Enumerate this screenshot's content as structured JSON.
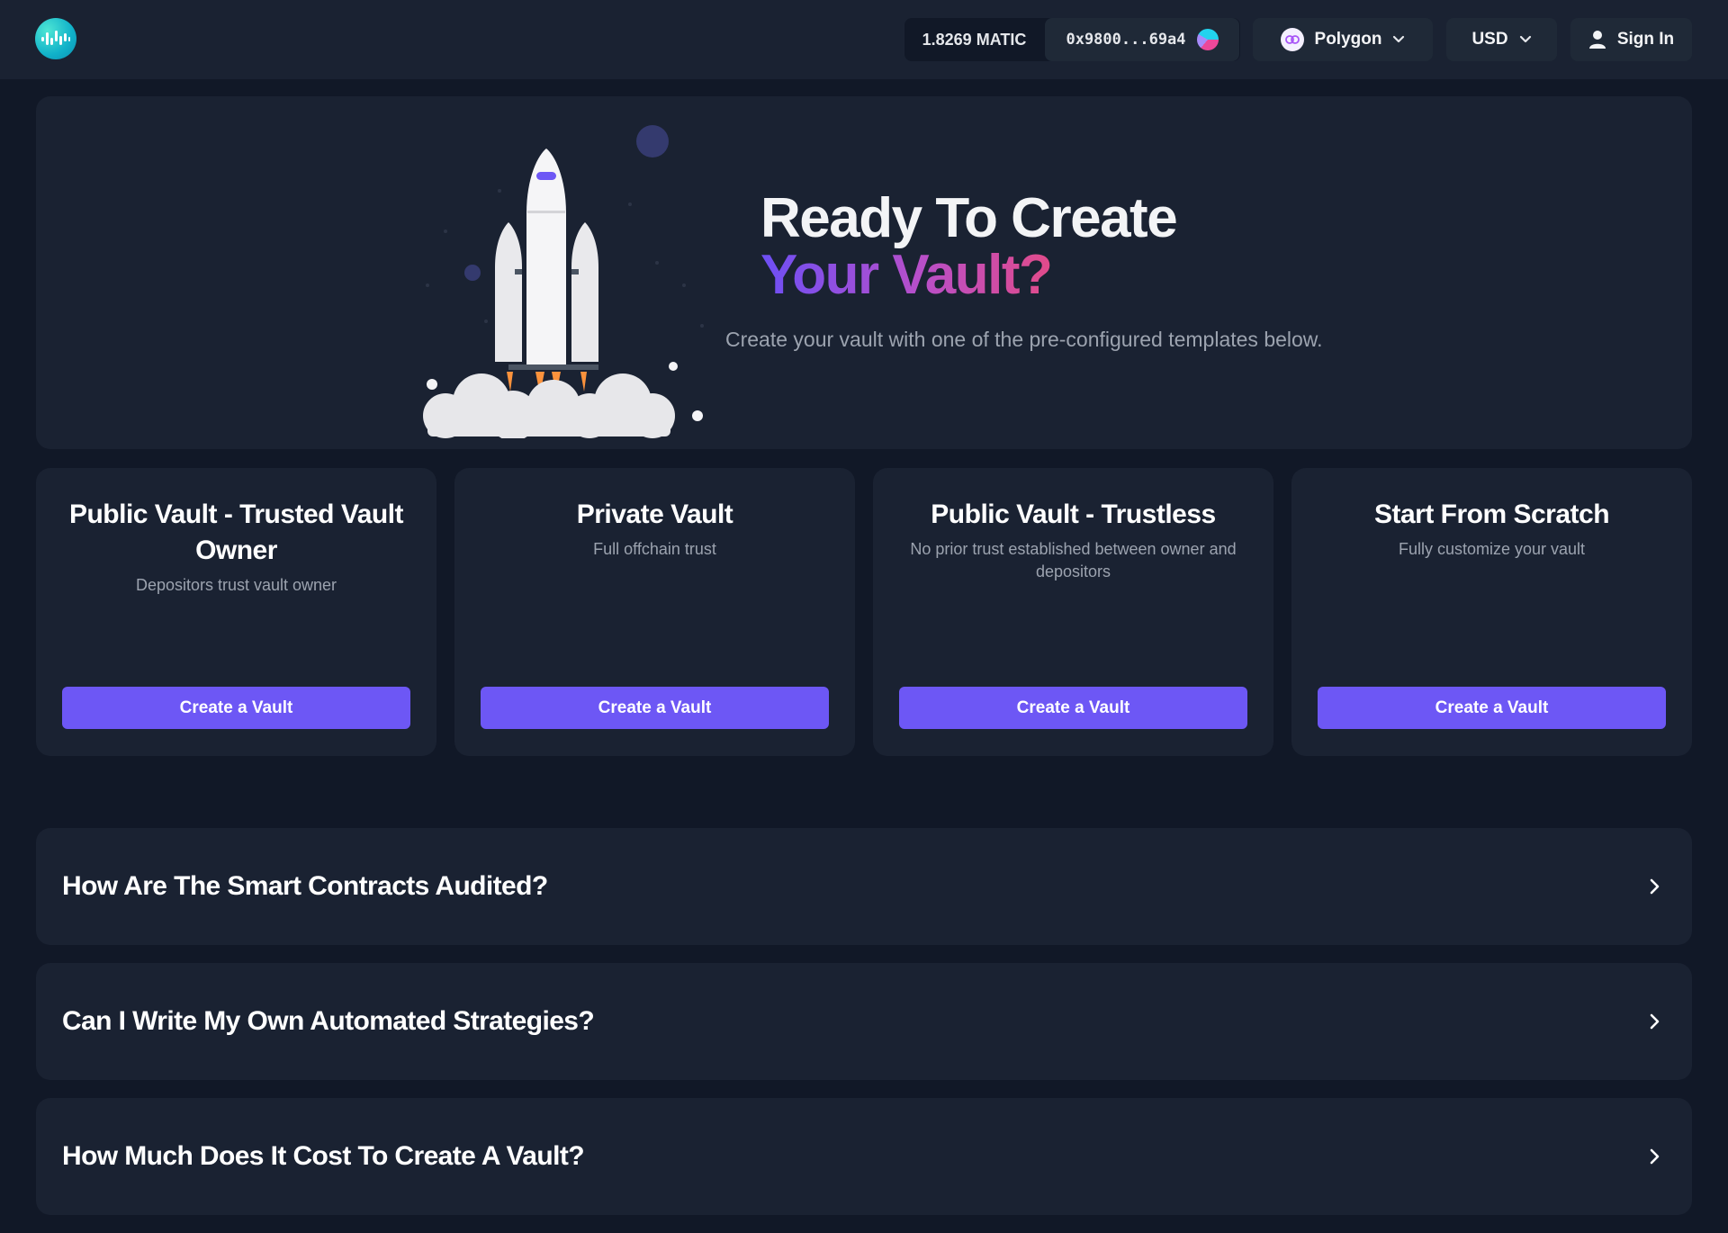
{
  "header": {
    "balance": "1.8269 MATIC",
    "address": "0x9800...69a4",
    "network": "Polygon",
    "currency": "USD",
    "sign_in": "Sign In"
  },
  "hero": {
    "title_line1": "Ready To Create",
    "title_line2": "Your Vault?",
    "subtitle": "Create your vault with one of the pre-configured templates below."
  },
  "templates": [
    {
      "title": "Public Vault - Trusted Vault Owner",
      "description": "Depositors trust vault owner",
      "button": "Create a Vault"
    },
    {
      "title": "Private Vault",
      "description": "Full offchain trust",
      "button": "Create a Vault"
    },
    {
      "title": "Public Vault - Trustless",
      "description": "No prior trust established between owner and depositors",
      "button": "Create a Vault"
    },
    {
      "title": "Start From Scratch",
      "description": "Fully customize your vault",
      "button": "Create a Vault"
    }
  ],
  "faq": [
    {
      "question": "How Are The Smart Contracts Audited?"
    },
    {
      "question": "Can I Write My Own Automated Strategies?"
    },
    {
      "question": "How Much Does It Cost To Create A Vault?"
    }
  ],
  "colors": {
    "background": "#111827",
    "panel": "#1a2232",
    "accent": "#6d57f5",
    "gradient_start": "#6d4ff5",
    "gradient_end": "#e14b8a"
  },
  "icons": {
    "logo": "waveform-logo",
    "network": "polygon-icon",
    "dropdown": "chevron-down-icon",
    "user": "user-icon",
    "faq": "chevron-right-icon",
    "hero": "rocket-illustration"
  }
}
